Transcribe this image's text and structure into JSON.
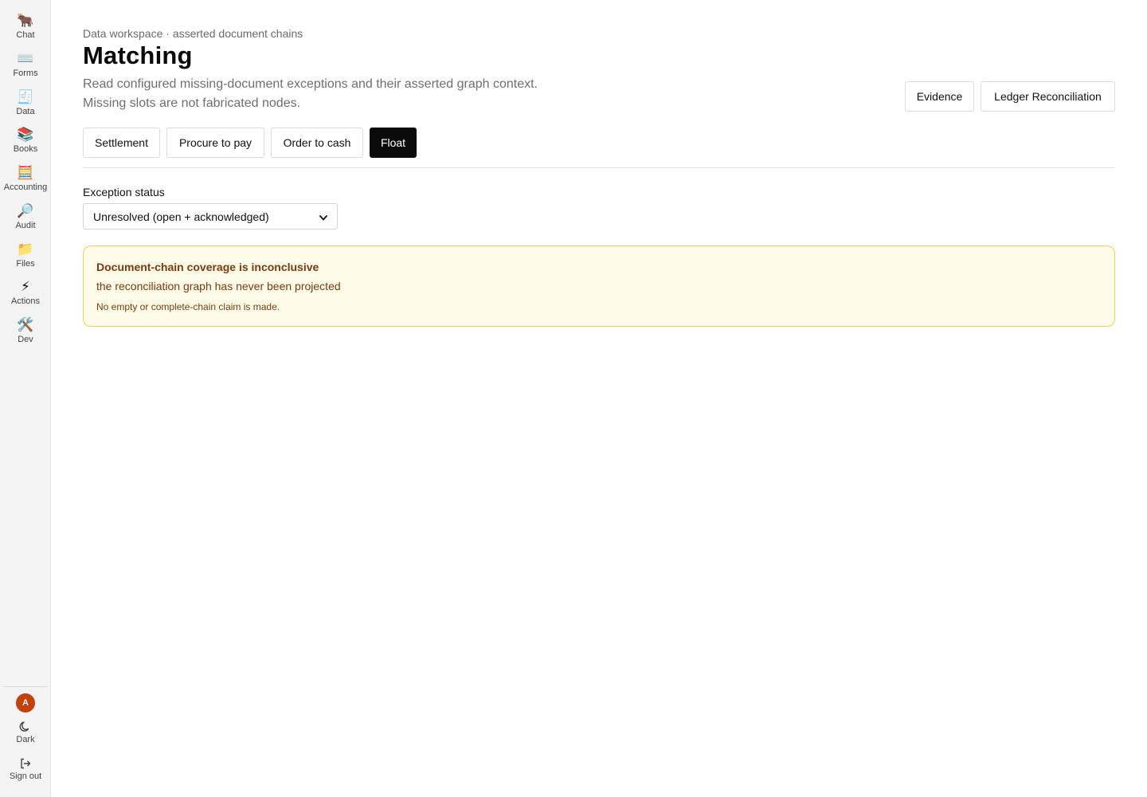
{
  "sidebar": {
    "items": [
      {
        "label": "Chat",
        "icon": "ox-icon",
        "glyph": "🐂"
      },
      {
        "label": "Forms",
        "icon": "keyboard-icon",
        "glyph": "⌨️"
      },
      {
        "label": "Data",
        "icon": "receipt-icon",
        "glyph": "🧾"
      },
      {
        "label": "Books",
        "icon": "books-icon",
        "glyph": "📚"
      },
      {
        "label": "Accounting",
        "icon": "abacus-icon",
        "glyph": "🧮"
      },
      {
        "label": "Audit",
        "icon": "magnifier-icon",
        "glyph": "🔎"
      },
      {
        "label": "Files",
        "icon": "folder-icon",
        "glyph": "📁"
      },
      {
        "label": "Actions",
        "icon": "lightning-icon",
        "glyph": "⚡"
      },
      {
        "label": "Dev",
        "icon": "tools-icon",
        "glyph": "🛠️"
      }
    ],
    "avatar_initial": "A",
    "dark_label": "Dark",
    "signout_label": "Sign out"
  },
  "header": {
    "breadcrumb": "Data workspace · asserted document chains",
    "title": "Matching",
    "description_line1": "Read configured missing-document exceptions and their asserted graph context.",
    "description_line2": "Missing slots are not fabricated nodes.",
    "actions": {
      "evidence_label": "Evidence",
      "ledger_label": "Ledger Reconciliation"
    }
  },
  "tabs": [
    {
      "label": "Settlement",
      "active": false
    },
    {
      "label": "Procure to pay",
      "active": false
    },
    {
      "label": "Order to cash",
      "active": false
    },
    {
      "label": "Float",
      "active": true
    }
  ],
  "filter": {
    "label": "Exception status",
    "selected": "Unresolved (open + acknowledged)"
  },
  "alert": {
    "title": "Document-chain coverage is inconclusive",
    "body": "the reconciliation graph has never been projected",
    "note": "No empty or complete-chain claim is made."
  },
  "colors": {
    "active_tab": "#0a0a0a",
    "avatar": "#c2410c",
    "alert_bg": "#fefbe8",
    "alert_border": "#f2cf52",
    "alert_text": "#7c3a0e"
  }
}
